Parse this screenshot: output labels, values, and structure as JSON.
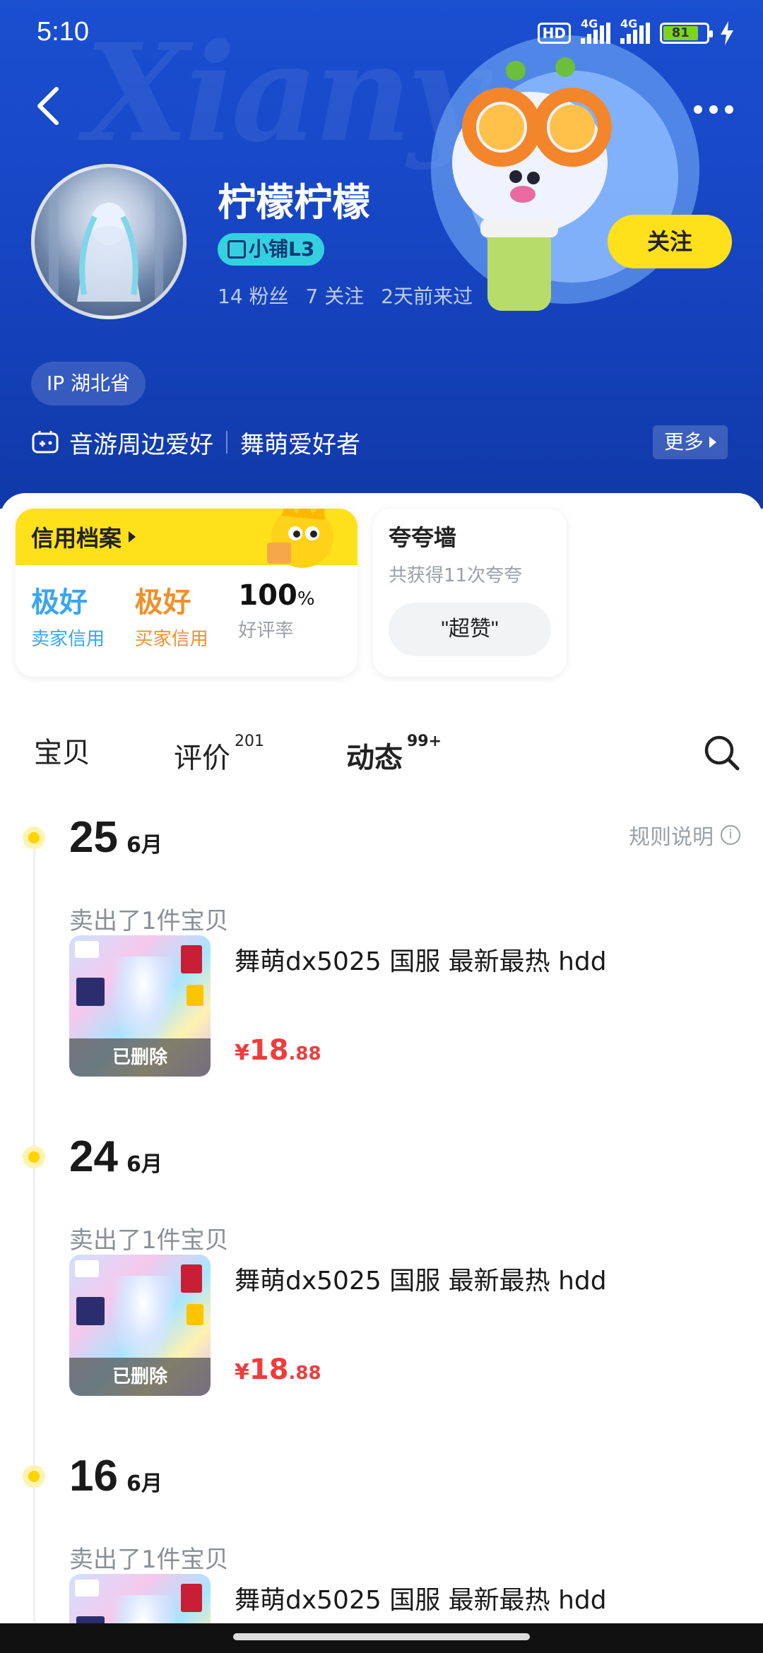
{
  "status_bar": {
    "time": "5:10",
    "battery": "81",
    "hd": "HD",
    "net1": "4G",
    "net2": "4G"
  },
  "header": {
    "watermark": "Xiany",
    "username": "柠檬柠檬",
    "shop_badge": "小铺L3",
    "followers": "14 粉丝",
    "following": "7 关注",
    "last_seen": "2天前来过",
    "follow_label": "关注",
    "ip_location": "IP 湖北省",
    "tags": [
      "音游周边爱好",
      "舞萌爱好者"
    ],
    "more_label": "更多"
  },
  "credit": {
    "title": "信用档案",
    "seller_rating": "极好",
    "seller_label": "卖家信用",
    "buyer_rating": "极好",
    "buyer_label": "买家信用",
    "positive_rate": "100",
    "positive_rate_unit": "%",
    "positive_label": "好评率"
  },
  "praise_wall": {
    "title": "夸夸墙",
    "subtitle": "共获得11次夸夸",
    "button_label": "\"超赞\""
  },
  "tabs": [
    {
      "label": "宝贝",
      "count": ""
    },
    {
      "label": "评价",
      "count": "201"
    },
    {
      "label": "动态",
      "count": "99+"
    }
  ],
  "rules_label": "规则说明",
  "timeline": [
    {
      "day": "25",
      "month": "6月",
      "event": "卖出了1件宝贝",
      "item_title": "舞萌dx5025 国服 最新最热 hdd",
      "deleted_label": "已删除",
      "price_symbol": "¥",
      "price_int": "18",
      "price_dec": ".88"
    },
    {
      "day": "24",
      "month": "6月",
      "event": "卖出了1件宝贝",
      "item_title": "舞萌dx5025 国服 最新最热 hdd",
      "deleted_label": "已删除",
      "price_symbol": "¥",
      "price_int": "18",
      "price_dec": ".88"
    },
    {
      "day": "16",
      "month": "6月",
      "event": "卖出了1件宝贝",
      "item_title": "舞萌dx5025 国服 最新最热 hdd",
      "deleted_label": "",
      "price_symbol": "",
      "price_int": "",
      "price_dec": ""
    }
  ],
  "colors": {
    "header_blue": "#1746c4",
    "accent_yellow": "#ffe11b",
    "price_red": "#f03c3c",
    "seller_blue": "#39a6f0",
    "buyer_orange": "#f0902a"
  },
  "icons": [
    "back-icon",
    "more-dots-icon",
    "shop-icon",
    "tag-icon",
    "chevron-right-icon",
    "search-icon",
    "info-icon"
  ]
}
